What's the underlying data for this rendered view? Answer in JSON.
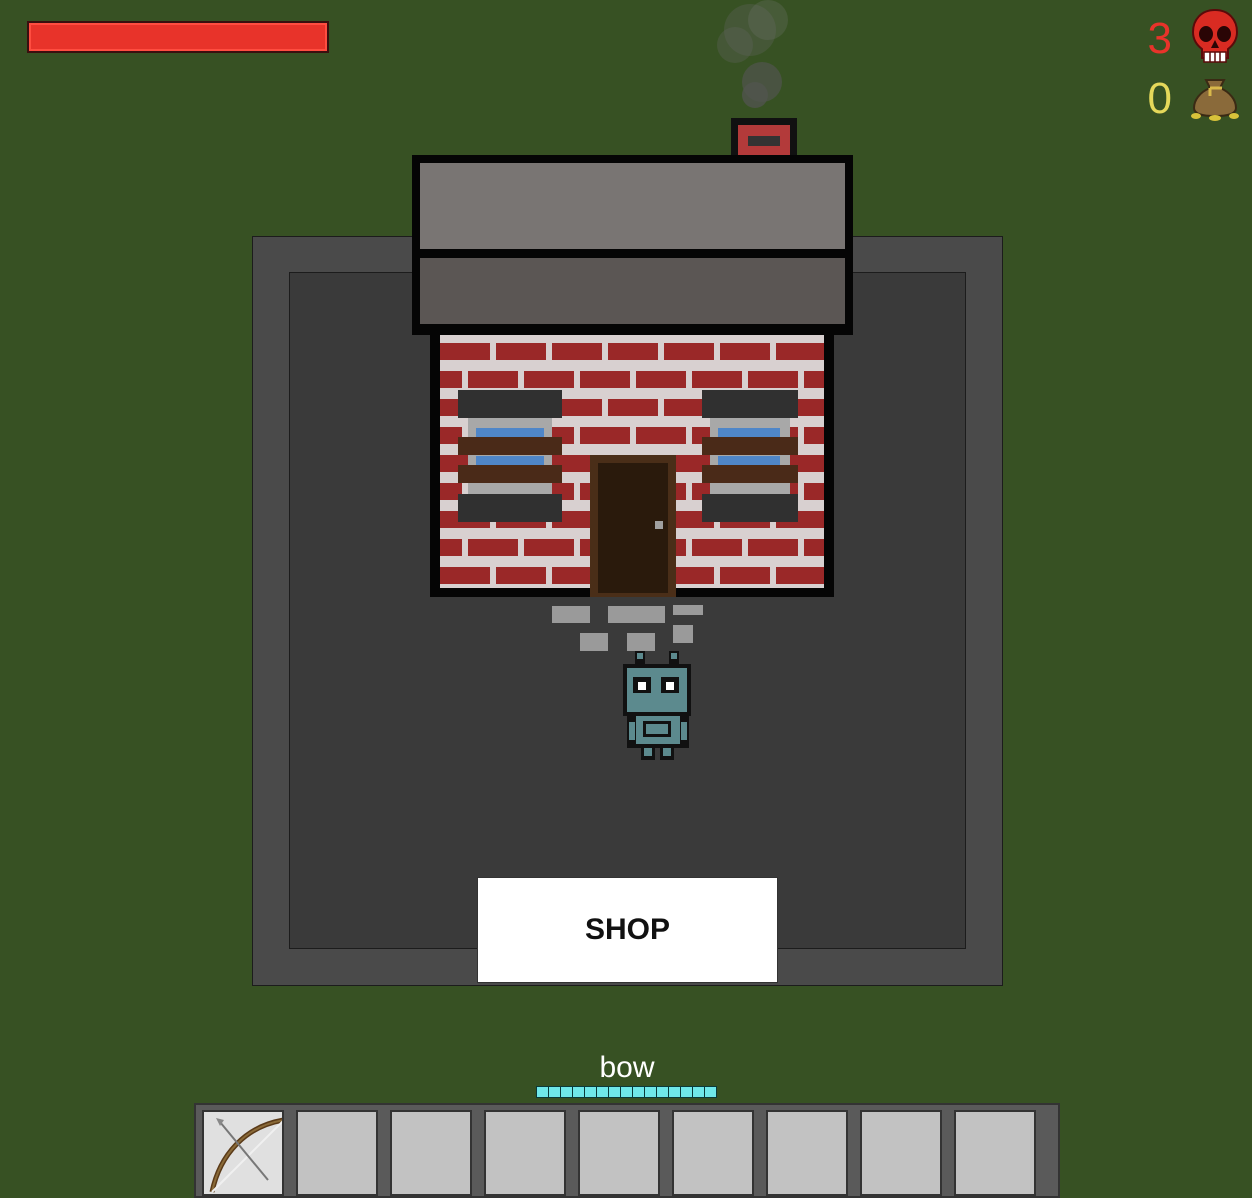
{
  "hud": {
    "health_fraction": 1.0,
    "kills": "3",
    "gold": "0",
    "kills_icon": "skull-icon",
    "gold_icon": "money-bag-icon"
  },
  "world": {
    "shop_button_label": "SHOP",
    "building": "brick-house",
    "player": "robot"
  },
  "inventory": {
    "selected_weapon": "bow",
    "ammo_count": 15,
    "slots": [
      {
        "item": "bow-icon",
        "selected": true
      },
      {
        "item": null
      },
      {
        "item": null
      },
      {
        "item": null
      },
      {
        "item": null
      },
      {
        "item": null
      },
      {
        "item": null
      },
      {
        "item": null
      },
      {
        "item": null
      }
    ]
  },
  "colors": {
    "background": "#375123",
    "health": "#e8332a",
    "kills": "#e8332a",
    "gold": "#e5d85a",
    "ammo": "#6fe8ea"
  }
}
